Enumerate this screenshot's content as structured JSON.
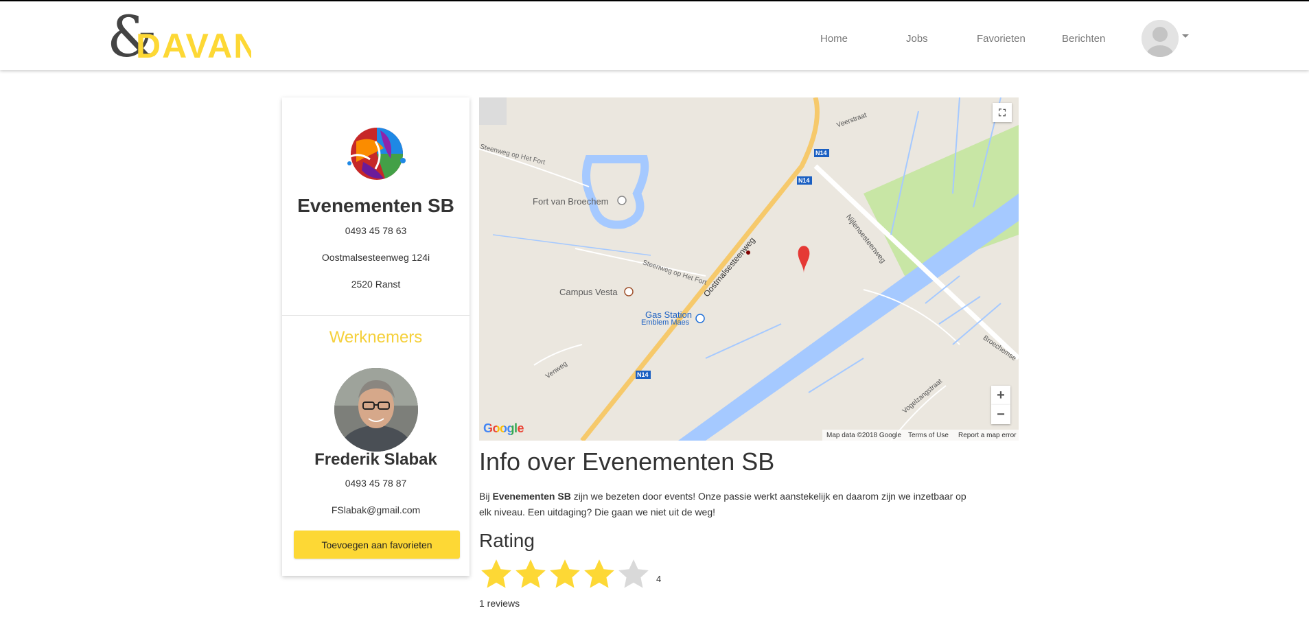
{
  "nav": {
    "logo_text": "DAVANT",
    "links": [
      "Home",
      "Jobs",
      "Favorieten",
      "Berichten"
    ]
  },
  "company": {
    "name": "Evenementen SB",
    "phone": "0493 45 78 63",
    "street": "Oostmalsesteenweg 124i",
    "city": "2520 Ranst"
  },
  "employees": {
    "title": "Werknemers",
    "name": "Frederik Slabak",
    "phone": "0493 45 78 87",
    "email": "FSlabak@gmail.com",
    "button_label": "Toevoegen aan favorieten"
  },
  "map": {
    "labels": {
      "fort": "Fort van Broechem",
      "campus": "Campus Vesta",
      "gas_station_1": "Gas Station",
      "gas_station_2": "Emblem Maes",
      "road_fort": "Steenweg op Het Fort",
      "road_fort2": "Steenweg op Het Fort",
      "road_oost": "Oostmalsesteenweg",
      "road_nijlen": "Nijlensesteenweg",
      "road_vogel": "Vogelzangstraat",
      "road_broechem": "Broechemse",
      "road_veer": "Veerstraat",
      "road_ven": "Venweg",
      "n14_1": "N14",
      "n14_2": "N14",
      "n14_3": "N14"
    },
    "footer": {
      "google": "Google",
      "map_data": "Map data ©2018 Google",
      "terms": "Terms of Use",
      "report": "Report a map error"
    },
    "zoom_in": "+",
    "zoom_out": "−"
  },
  "about": {
    "title": "Info over Evenementen SB",
    "text_prefix": "Bij ",
    "text_bold": "Evenementen SB",
    "text_suffix": " zijn we bezeten door events! Onze passie werkt aanstekelijk en daarom zijn we inzetbaar op elk niveau. Een uitdaging? Die gaan we niet uit de weg!"
  },
  "rating": {
    "title": "Rating",
    "value": 4,
    "max": 5,
    "value_label": "4",
    "reviews": "1 reviews"
  },
  "colors": {
    "accent": "#fdd835",
    "section_title": "#f5d03b",
    "star_filled": "#fdd835",
    "star_empty": "#d9d9d9",
    "water": "#a5c9ff",
    "park": "#c8e6a5"
  }
}
